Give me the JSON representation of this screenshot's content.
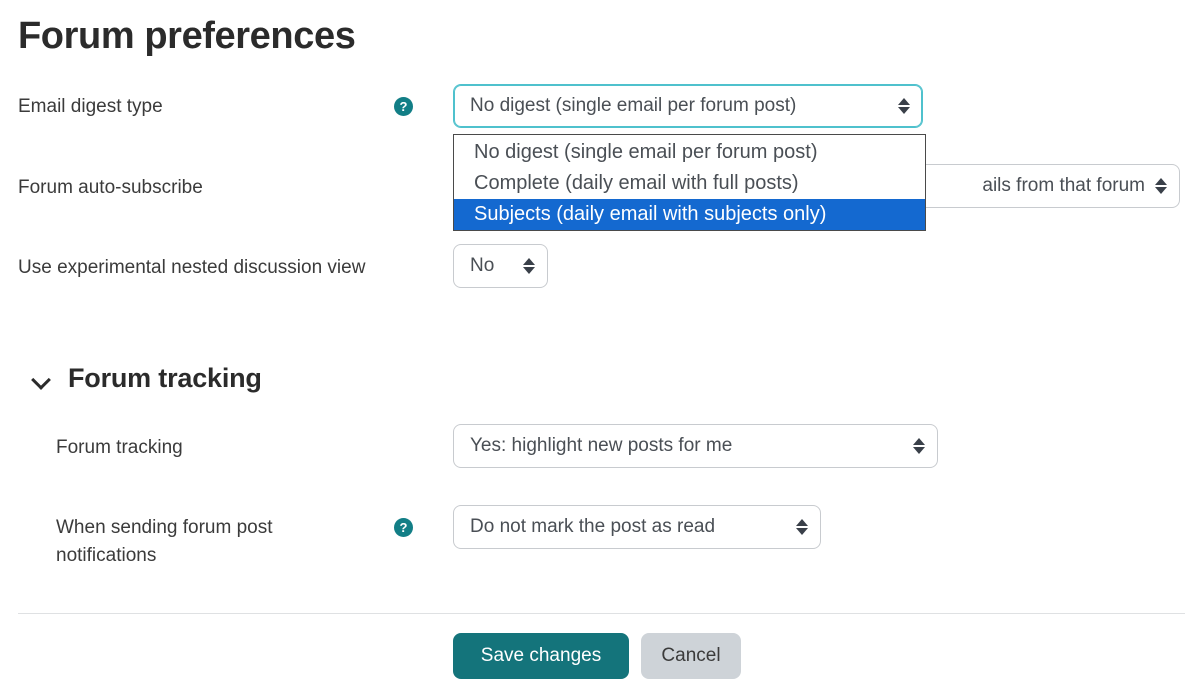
{
  "page": {
    "title": "Forum preferences"
  },
  "fields": {
    "email_digest": {
      "label": "Email digest type",
      "help_icon": "help-question-icon",
      "value": "No digest (single email per forum post)",
      "expanded": true,
      "options": [
        "No digest (single email per forum post)",
        "Complete (daily email with full posts)",
        "Subjects (daily email with subjects only)"
      ],
      "highlighted_option": "Subjects (daily email with subjects only)"
    },
    "auto_subscribe": {
      "label": "Forum auto-subscribe",
      "value": "ails from that forum"
    },
    "nested_view": {
      "label": "Use experimental nested discussion view",
      "value": "No"
    }
  },
  "tracking_section": {
    "title": "Forum tracking",
    "chevron_icon": "chevron-down-icon",
    "fields": {
      "forum_tracking": {
        "label": "Forum tracking",
        "value": "Yes: highlight new posts for me"
      },
      "notifications": {
        "label": "When sending forum post notifications",
        "help_icon": "help-question-icon",
        "value": "Do not mark the post as read"
      }
    }
  },
  "footer": {
    "save_label": "Save changes",
    "cancel_label": "Cancel"
  },
  "colors": {
    "accent_teal": "#14747b",
    "help_teal": "#127e86",
    "highlight_blue": "#1469d0",
    "focus_cyan": "#4fc1cd"
  }
}
